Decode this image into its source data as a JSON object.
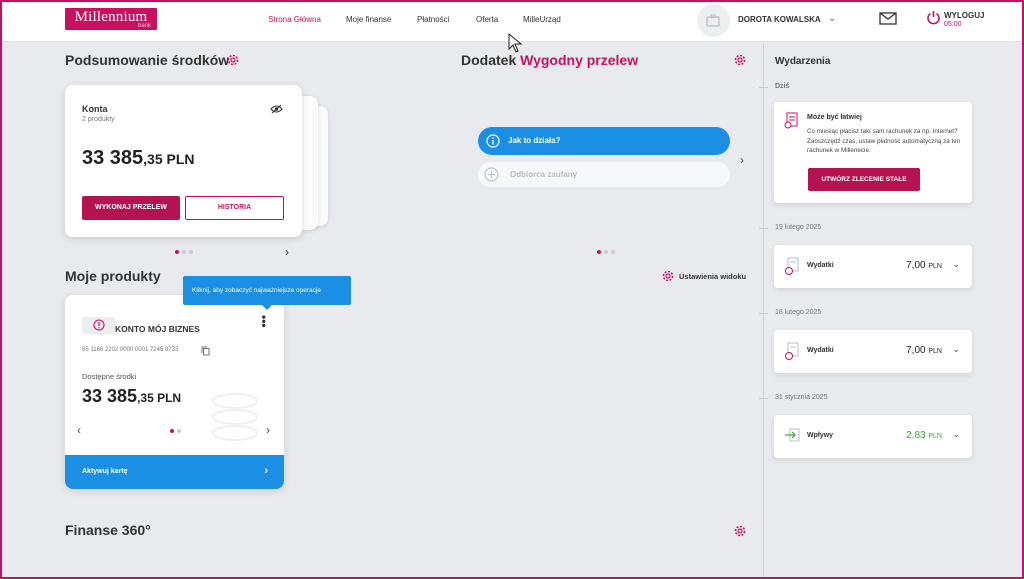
{
  "header": {
    "logo_text": "Millennium",
    "logo_sub": "bank",
    "nav": [
      "Strona Główna",
      "Moje finanse",
      "Płatności",
      "Oferta",
      "MilleUrząd"
    ],
    "user_name": "DOROTA KOWALSKA",
    "logout_label": "WYLOGUJ",
    "logout_timer": "05:00"
  },
  "summary": {
    "title": "Podsumowanie środków",
    "card_title": "Konta",
    "card_subtitle": "2 produkty",
    "amount_int": "33 385",
    "amount_dec": ",35 PLN",
    "transfer_button": "WYKONAJ PRZELEW",
    "history_button": "HISTORIA"
  },
  "addon": {
    "title_prefix": "Dodatek",
    "title_highlight": "Wygodny przelew",
    "how_it_works": "Jak to działa?",
    "trusted_recipient": "Odbiorca zaufany"
  },
  "products": {
    "title": "Moje produkty",
    "view_settings": "Ustawienia widoku",
    "tooltip": "Kliknij, aby zobaczyć najważniejsze operacje",
    "account_name": "KONTO MÓJ BIZNES",
    "account_number": "55 1160 2202 0000 0001 7245 8733",
    "available_label": "Dostępne środki",
    "amount_int": "33 385",
    "amount_dec": ",35 PLN",
    "activate_card": "Aktywuj kartę"
  },
  "finance": {
    "title": "Finanse 360°"
  },
  "events": {
    "title": "Wydarzenia",
    "today_label": "Dziś",
    "promo_title": "Może być łatwiej",
    "promo_text": "Co miesiąc płacisz taki sam rachunek za np. Internet? Zaoszczędź czas, ustaw płatność automatyczną za ten rachunek w Millenecie.",
    "promo_button": "UTWÓRZ ZLECENIE STAŁE",
    "items": [
      {
        "date": "19 lutego 2025",
        "label": "Wydatki",
        "amount_int": "7,00",
        "currency": "PLN"
      },
      {
        "date": "18 lutego 2025",
        "label": "Wydatki",
        "amount_int": "7,00",
        "currency": "PLN"
      },
      {
        "date": "31 stycznia 2025",
        "label": "Wpływy",
        "amount_int": "2,83",
        "currency": "PLN"
      }
    ]
  },
  "colors": {
    "brand": "#c8105f",
    "blue": "#1a8fe3",
    "income": "#3aa52e"
  }
}
